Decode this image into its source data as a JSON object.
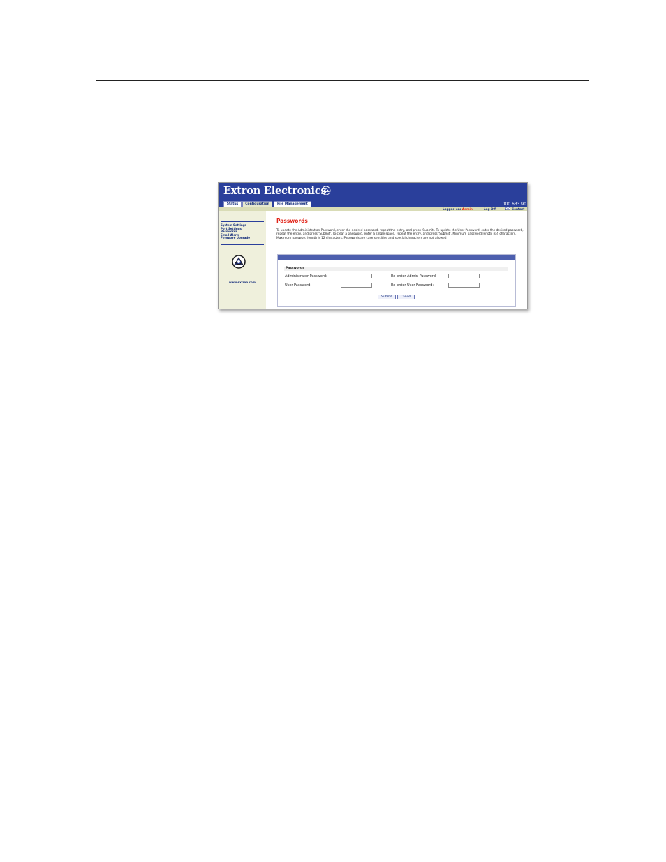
{
  "app": {
    "brand_name": "Extron Electronics",
    "ip_address": "000.633.90",
    "accent_color": "#2a3f9b",
    "title_color": "#e2261b"
  },
  "tabs": [
    {
      "label": "Status"
    },
    {
      "label": "Configuration"
    },
    {
      "label": "File Management"
    }
  ],
  "topbar": {
    "logged_on_label": "Logged on:",
    "logged_on_user": "Admin",
    "logoff_label": "Log Off",
    "contact_label": "Contact"
  },
  "sidebar": {
    "items": [
      {
        "label": "System Settings"
      },
      {
        "label": "Port Settings"
      },
      {
        "label": "Passwords"
      },
      {
        "label": "Email Alerts"
      },
      {
        "label": "Firmware Upgrade"
      }
    ],
    "website": "www.extron.com"
  },
  "main": {
    "title": "Passwords",
    "description": "To update the Administration Password, enter the desired password, repeat the entry, and press 'Submit'.  To update the User Password, enter the desired password, repeat the entry, and press 'Submit'.  To clear a password, enter a single space, repeat the entry, and press 'Submit'.  Minimum password length is 4 characters.  Maximum password length is 12 characters. Passwords are case sensitive and special characters are not allowed.",
    "group_label": "Passwords",
    "admin_password_label": "Administrator Password:",
    "reenter_admin_label": "Re-enter Admin Password:",
    "user_password_label": "User Password:",
    "reenter_user_label": "Re-enter User Password:",
    "admin_password_value": "",
    "reenter_admin_value": "",
    "user_password_value": "",
    "reenter_user_value": "",
    "submit_label": "Submit",
    "cancel_label": "Cancel"
  }
}
